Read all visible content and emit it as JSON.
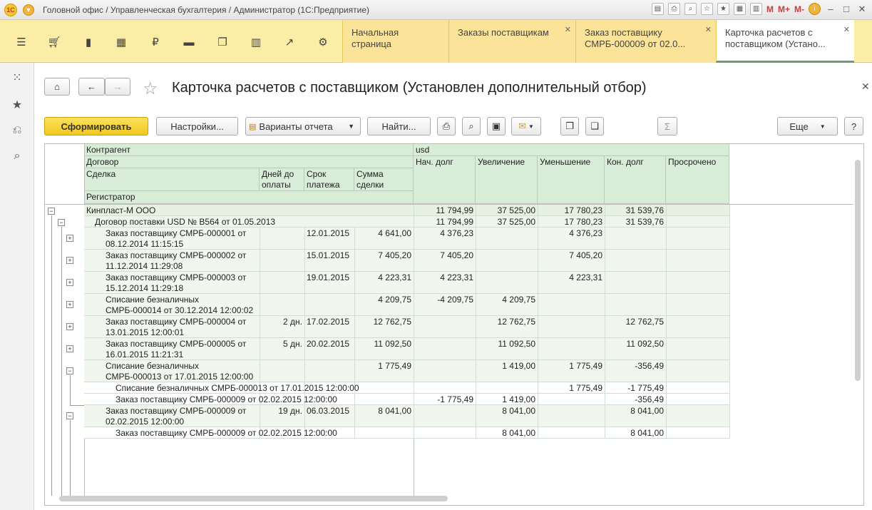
{
  "window": {
    "title": "Головной офис / Управленческая бухгалтерия / Администратор  (1С:Предприятие)",
    "tools": [
      "M",
      "M+",
      "M-"
    ]
  },
  "tabs": [
    {
      "label": "Начальная страница",
      "closable": false
    },
    {
      "label": "Заказы поставщикам",
      "closable": true
    },
    {
      "label": "Заказ поставщику СМРБ-000009 от 02.0...",
      "closable": true
    },
    {
      "label": "Карточка расчетов с поставщиком (Устано...",
      "closable": true
    }
  ],
  "form": {
    "title": "Карточка расчетов с поставщиком (Установлен дополнительный отбор)",
    "buttons": {
      "generate": "Сформировать",
      "settings": "Настройки...",
      "variants": "Варианты отчета",
      "find": "Найти...",
      "more": "Еще",
      "help": "?"
    }
  },
  "report": {
    "headers": {
      "kontragent": "Контрагент",
      "dogovor": "Договор",
      "sdelka": "Сделка",
      "dney": "Дней до оплаты",
      "srok": "Срок платежа",
      "summa": "Сумма сделки",
      "registrator": "Регистратор",
      "currency": "usd",
      "nach": "Нач. долг",
      "uvel": "Увеличение",
      "umen": "Уменьшение",
      "kon": "Кон. долг",
      "prosr": "Просрочено"
    },
    "rows": [
      {
        "level": 0,
        "name": "Кинпласт-М ООО",
        "dney": "",
        "srok": "",
        "summa": "",
        "nach": "11 794,99",
        "uvel": "37 525,00",
        "umen": "17 780,23",
        "kon": "31 539,76",
        "prosr": ""
      },
      {
        "level": 1,
        "name": "Договор поставки USD № В564 от 01.05.2013",
        "dney": "",
        "srok": "",
        "summa": "",
        "nach": "11 794,99",
        "uvel": "37 525,00",
        "umen": "17 780,23",
        "kon": "31 539,76",
        "prosr": ""
      },
      {
        "level": 2,
        "name": "Заказ поставщику СМРБ-000001 от",
        "name2": "08.12.2014 11:15:15",
        "dney": "",
        "srok": "12.01.2015",
        "summa": "4 641,00",
        "nach": "4 376,23",
        "uvel": "",
        "umen": "4 376,23",
        "kon": "",
        "prosr": ""
      },
      {
        "level": 2,
        "name": "Заказ поставщику СМРБ-000002 от",
        "name2": "11.12.2014 11:29:08",
        "dney": "",
        "srok": "15.01.2015",
        "summa": "7 405,20",
        "nach": "7 405,20",
        "uvel": "",
        "umen": "7 405,20",
        "kon": "",
        "prosr": ""
      },
      {
        "level": 2,
        "name": "Заказ поставщику СМРБ-000003 от",
        "name2": "15.12.2014 11:29:18",
        "dney": "",
        "srok": "19.01.2015",
        "summa": "4 223,31",
        "nach": "4 223,31",
        "uvel": "",
        "umen": "4 223,31",
        "kon": "",
        "prosr": ""
      },
      {
        "level": 2,
        "name": "Списание безналичных",
        "name2": "СМРБ-000014 от 30.12.2014 12:00:02",
        "dney": "",
        "srok": "",
        "summa": "4 209,75",
        "nach": "-4 209,75",
        "uvel": "4 209,75",
        "umen": "",
        "kon": "",
        "prosr": ""
      },
      {
        "level": 2,
        "name": "Заказ поставщику СМРБ-000004 от",
        "name2": "13.01.2015 12:00:01",
        "dney": "2 дн.",
        "srok": "17.02.2015",
        "summa": "12 762,75",
        "nach": "",
        "uvel": "12 762,75",
        "umen": "",
        "kon": "12 762,75",
        "prosr": ""
      },
      {
        "level": 2,
        "name": "Заказ поставщику СМРБ-000005 от",
        "name2": "16.01.2015 11:21:31",
        "dney": "5 дн.",
        "srok": "20.02.2015",
        "summa": "11 092,50",
        "nach": "",
        "uvel": "11 092,50",
        "umen": "",
        "kon": "11 092,50",
        "prosr": ""
      },
      {
        "level": 2,
        "name": "Списание безналичных",
        "name2": "СМРБ-000013 от 17.01.2015 12:00:00",
        "dney": "",
        "srok": "",
        "summa": "1 775,49",
        "nach": "",
        "uvel": "1 419,00",
        "umen": "1 775,49",
        "kon": "-356,49",
        "prosr": ""
      },
      {
        "level": 3,
        "name": "Списание безналичных СМРБ-000013 от 17.01.2015 12:00:00",
        "dney": "",
        "srok": "",
        "summa": "",
        "nach": "",
        "uvel": "",
        "umen": "1 775,49",
        "kon": "-1 775,49",
        "prosr": ""
      },
      {
        "level": 3,
        "name": "Заказ поставщику СМРБ-000009 от 02.02.2015 12:00:00",
        "dney": "",
        "srok": "",
        "summa": "",
        "nach": "-1 775,49",
        "uvel": "1 419,00",
        "umen": "",
        "kon": "-356,49",
        "prosr": ""
      },
      {
        "level": 2,
        "name": "Заказ поставщику СМРБ-000009 от",
        "name2": "02.02.2015 12:00:00",
        "dney": "19 дн.",
        "srok": "06.03.2015",
        "summa": "8 041,00",
        "nach": "",
        "uvel": "8 041,00",
        "umen": "",
        "kon": "8 041,00",
        "prosr": ""
      },
      {
        "level": 3,
        "name": "Заказ поставщику СМРБ-000009 от 02.02.2015 12:00:00",
        "dney": "",
        "srok": "",
        "summa": "",
        "nach": "",
        "uvel": "8 041,00",
        "umen": "",
        "kon": "8 041,00",
        "prosr": ""
      }
    ]
  }
}
